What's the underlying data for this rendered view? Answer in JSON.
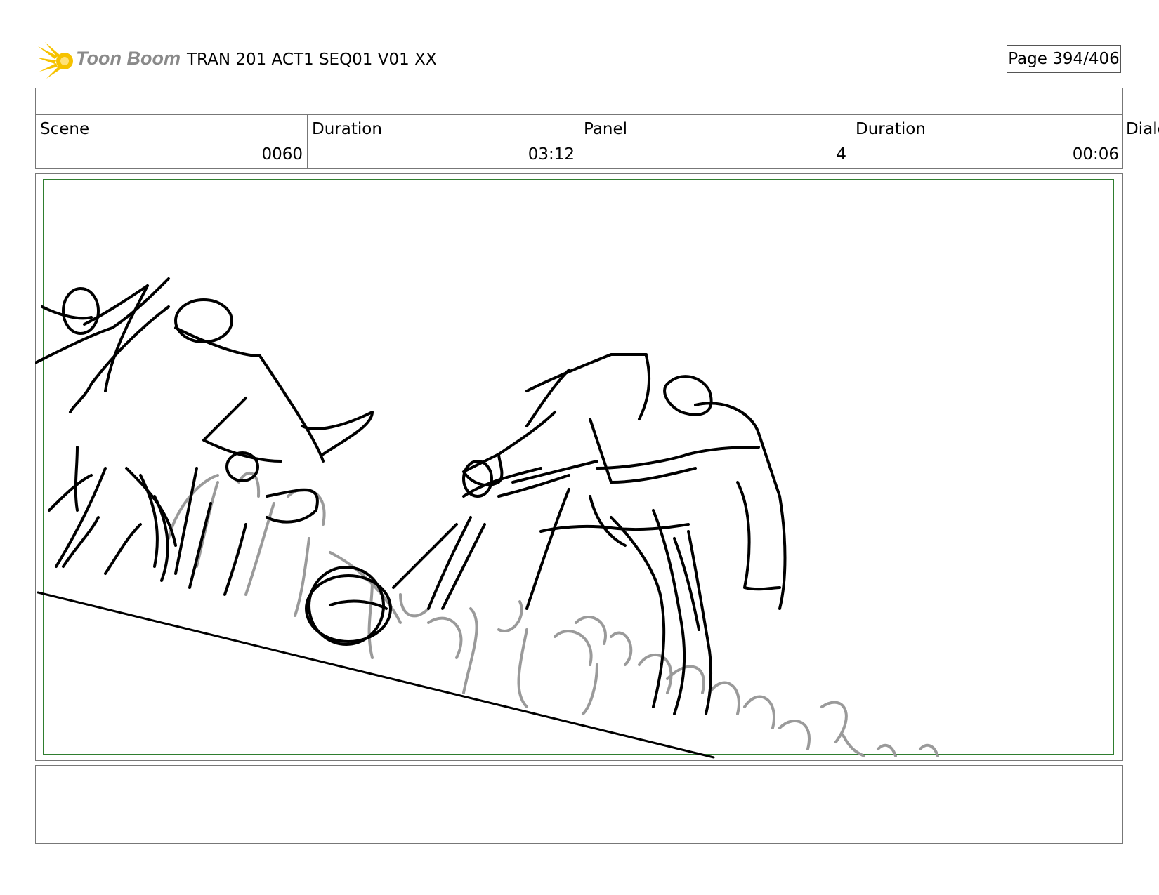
{
  "header": {
    "logo_text": "Toon Boom",
    "title": "TRAN 201 ACT1 SEQ01 V01 XX",
    "page": "Page 394/406"
  },
  "info": {
    "scene_label": "Scene",
    "scene_value": "0060",
    "scene_duration_label": "Duration",
    "scene_duration_value": "03:12",
    "panel_label": "Panel",
    "panel_value": "4",
    "panel_duration_label": "Duration",
    "panel_duration_value": "00:06",
    "dialog_label": "Dialo"
  },
  "colors": {
    "safe_frame": "#2f7d2f",
    "logo_star": "#f6c200"
  },
  "icons": [
    "toon-boom-star-icon"
  ]
}
